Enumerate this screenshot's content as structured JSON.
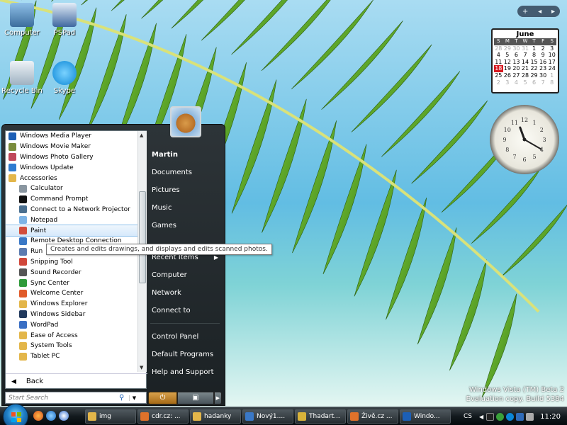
{
  "desktop": {
    "icons": [
      {
        "label": "Computer"
      },
      {
        "label": "PSPad"
      },
      {
        "label": "Recycle Bin"
      },
      {
        "label": "Skype"
      }
    ],
    "watermark": {
      "line1": "Windows Vista (TM) Beta 2",
      "line2": "Evaluation copy. Build 5384"
    }
  },
  "gadgets": {
    "bar": {
      "add": "+",
      "prev": "◂",
      "next": "▸"
    },
    "calendar": {
      "month": "June",
      "weekdays": [
        "S",
        "M",
        "T",
        "W",
        "T",
        "F",
        "S"
      ],
      "weeks": [
        [
          "28",
          "29",
          "30",
          "31",
          "1",
          "2",
          "3"
        ],
        [
          "4",
          "5",
          "6",
          "7",
          "8",
          "9",
          "10"
        ],
        [
          "11",
          "12",
          "13",
          "14",
          "15",
          "16",
          "17"
        ],
        [
          "18",
          "19",
          "20",
          "21",
          "22",
          "23",
          "24"
        ],
        [
          "25",
          "26",
          "27",
          "28",
          "29",
          "30",
          "1"
        ],
        [
          "2",
          "3",
          "4",
          "5",
          "6",
          "7",
          "8"
        ]
      ],
      "today": "18",
      "today_color": "#d71920"
    },
    "clock": {
      "time": "11:20"
    }
  },
  "start_menu": {
    "programs": [
      {
        "label": "Windows Media Player",
        "icon": "media-player-icon",
        "level": 1,
        "color": "#1c5fb6"
      },
      {
        "label": "Windows Movie Maker",
        "icon": "movie-maker-icon",
        "level": 1,
        "color": "#7a8c3c"
      },
      {
        "label": "Windows Photo Gallery",
        "icon": "photo-gallery-icon",
        "level": 1,
        "color": "#c0485a"
      },
      {
        "label": "Windows Update",
        "icon": "windows-update-icon",
        "level": 1,
        "color": "#2e7bd0"
      },
      {
        "label": "Accessories",
        "icon": "folder-icon",
        "level": 1,
        "color": "#e3b64a"
      },
      {
        "label": "Calculator",
        "icon": "calculator-icon",
        "level": 2,
        "color": "#8a96a0"
      },
      {
        "label": "Command Prompt",
        "icon": "command-prompt-icon",
        "level": 2,
        "color": "#111111"
      },
      {
        "label": "Connect to a Network Projector",
        "icon": "projector-icon",
        "level": 2,
        "color": "#4a6f8f"
      },
      {
        "label": "Notepad",
        "icon": "notepad-icon",
        "level": 2,
        "color": "#7db4e6"
      },
      {
        "label": "Paint",
        "icon": "paint-icon",
        "level": 2,
        "color": "#d24c3a",
        "selected": true
      },
      {
        "label": "Remote Desktop Connection",
        "icon": "remote-desktop-icon",
        "level": 2,
        "color": "#3a78c6"
      },
      {
        "label": "Run",
        "icon": "run-icon",
        "level": 2,
        "color": "#5b7bb0"
      },
      {
        "label": "Snipping Tool",
        "icon": "scissors-icon",
        "level": 2,
        "color": "#d0473a"
      },
      {
        "label": "Sound Recorder",
        "icon": "microphone-icon",
        "level": 2,
        "color": "#555555"
      },
      {
        "label": "Sync Center",
        "icon": "sync-icon",
        "level": 2,
        "color": "#2f9a3a"
      },
      {
        "label": "Welcome Center",
        "icon": "windows-flag-icon",
        "level": 2,
        "color": "#e05b2a"
      },
      {
        "label": "Windows Explorer",
        "icon": "explorer-icon",
        "level": 2,
        "color": "#e3b64a"
      },
      {
        "label": "Windows Sidebar",
        "icon": "sidebar-icon",
        "level": 2,
        "color": "#223a5e"
      },
      {
        "label": "WordPad",
        "icon": "wordpad-icon",
        "level": 2,
        "color": "#3a6fc4"
      },
      {
        "label": "Ease of Access",
        "icon": "folder-icon",
        "level": 2,
        "color": "#e3b64a"
      },
      {
        "label": "System Tools",
        "icon": "folder-icon",
        "level": 2,
        "color": "#e3b64a"
      },
      {
        "label": "Tablet PC",
        "icon": "folder-icon",
        "level": 2,
        "color": "#e3b64a"
      }
    ],
    "back_label": "Back",
    "search_placeholder": "Start Search",
    "tooltip": "Creates and edits drawings, and displays and edits scanned photos.",
    "right_pane": {
      "user": "Martin",
      "group1": [
        "Documents",
        "Pictures",
        "Music",
        "Games"
      ],
      "recent_items": "Recent Items",
      "group2": [
        "Computer",
        "Network",
        "Connect to"
      ],
      "group3": [
        "Control Panel",
        "Default Programs",
        "Help and Support"
      ]
    }
  },
  "taskbar": {
    "buttons": [
      {
        "label": "img",
        "icon": "folder-icon",
        "color": "#e3b64a"
      },
      {
        "label": "cdr.cz: ...",
        "icon": "firefox-icon",
        "color": "#e0722a"
      },
      {
        "label": "hadanky",
        "icon": "folder-icon",
        "color": "#e3b64a"
      },
      {
        "label": "Nový1....",
        "icon": "pspad-icon",
        "color": "#3a78c6"
      },
      {
        "label": "Thadart...",
        "icon": "document-icon",
        "color": "#d9b33a"
      },
      {
        "label": "Živě.cz ...",
        "icon": "firefox-icon",
        "color": "#e0722a"
      },
      {
        "label": "Windo...",
        "icon": "media-player-icon",
        "color": "#1c5fb6"
      }
    ],
    "tray": {
      "language": "CS",
      "time": "11:20"
    }
  }
}
